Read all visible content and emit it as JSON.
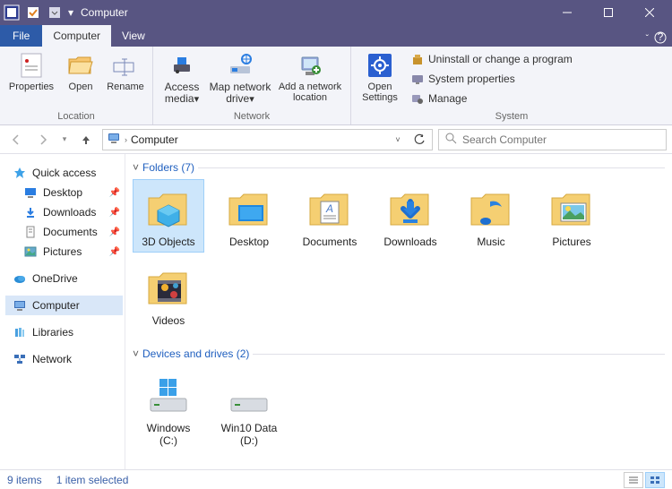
{
  "titlebar": {
    "title": "Computer"
  },
  "window": {
    "minimize": "–",
    "maximize": "☐",
    "close": "✕"
  },
  "tabs": {
    "file": "File",
    "computer": "Computer",
    "view": "View"
  },
  "ribbon": {
    "location": {
      "label": "Location",
      "properties": "Properties",
      "open": "Open",
      "rename": "Rename"
    },
    "network": {
      "label": "Network",
      "access_media": "Access media",
      "map_drive": "Map network drive",
      "add_location": "Add a network location"
    },
    "system": {
      "label": "System",
      "open_settings": "Open Settings",
      "uninstall": "Uninstall or change a program",
      "properties": "System properties",
      "manage": "Manage"
    }
  },
  "address": {
    "root": "Computer"
  },
  "search": {
    "placeholder": "Search Computer"
  },
  "tree": {
    "quick_access": "Quick access",
    "desktop": "Desktop",
    "downloads": "Downloads",
    "documents": "Documents",
    "pictures": "Pictures",
    "onedrive": "OneDrive",
    "computer": "Computer",
    "libraries": "Libraries",
    "network": "Network"
  },
  "sections": {
    "folders": "Folders (7)",
    "drives": "Devices and drives (2)"
  },
  "folders": {
    "objects3d": "3D Objects",
    "desktop": "Desktop",
    "documents": "Documents",
    "downloads": "Downloads",
    "music": "Music",
    "pictures": "Pictures",
    "videos": "Videos"
  },
  "drives": {
    "c": "Windows (C:)",
    "d": "Win10 Data (D:)"
  },
  "status": {
    "items": "9 items",
    "selected": "1 item selected"
  }
}
